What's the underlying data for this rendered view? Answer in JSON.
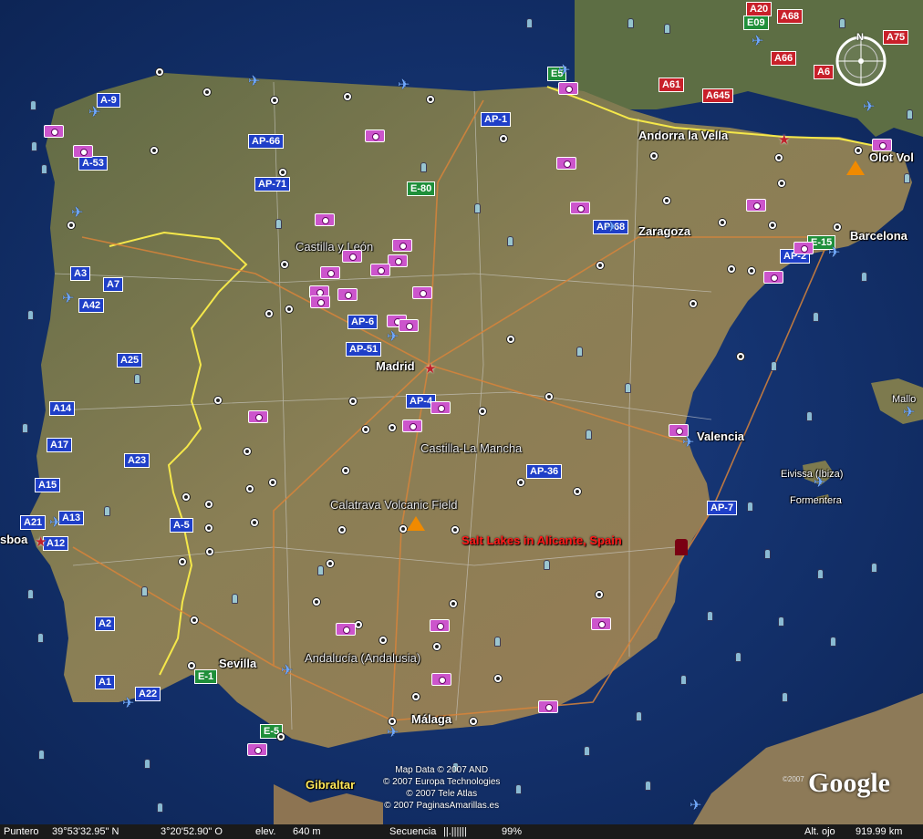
{
  "map": {
    "places": [
      {
        "key": "andorra",
        "label": "Andorra la Vella"
      },
      {
        "key": "olot",
        "label": "Olot Vol"
      },
      {
        "key": "zaragoza",
        "label": "Zaragoza"
      },
      {
        "key": "barcelona",
        "label": "Barcelona"
      },
      {
        "key": "castilla_leon",
        "label": "Castilla y León"
      },
      {
        "key": "madrid",
        "label": "Madrid"
      },
      {
        "key": "valencia",
        "label": "Valencia"
      },
      {
        "key": "castilla_mancha",
        "label": "Castilla-La Mancha"
      },
      {
        "key": "mallorca",
        "label": "Mallo"
      },
      {
        "key": "eivissa",
        "label": "Eivissa (Ibiza)"
      },
      {
        "key": "formentera",
        "label": "Formentera"
      },
      {
        "key": "lisboa",
        "label": "sboa"
      },
      {
        "key": "calatrava",
        "label": "Calatrava Volcanic Field"
      },
      {
        "key": "sevilla",
        "label": "Sevilla"
      },
      {
        "key": "andalucia",
        "label": "Andalucía (Andalusia)"
      },
      {
        "key": "malaga",
        "label": "Málaga"
      },
      {
        "key": "gibraltar",
        "label": "Gibraltar"
      }
    ],
    "feature_label": "Salt Lakes in Alicante, Spain",
    "roads": [
      {
        "key": "e09",
        "label": "E09",
        "color": "green"
      },
      {
        "key": "a68",
        "label": "A68",
        "color": "red"
      },
      {
        "key": "a20",
        "label": "A20",
        "color": "red"
      },
      {
        "key": "a75",
        "label": "A75",
        "color": "red"
      },
      {
        "key": "a66",
        "label": "A66",
        "color": "red"
      },
      {
        "key": "a6x",
        "label": "A6",
        "color": "red"
      },
      {
        "key": "a61",
        "label": "A61",
        "color": "red"
      },
      {
        "key": "a645",
        "label": "A645",
        "color": "red"
      },
      {
        "key": "e5",
        "label": "E5",
        "color": "green"
      },
      {
        "key": "a9",
        "label": "A-9",
        "color": "blue"
      },
      {
        "key": "ap1",
        "label": "AP-1",
        "color": "blue"
      },
      {
        "key": "a53",
        "label": "A-53",
        "color": "blue"
      },
      {
        "key": "ap66",
        "label": "AP-66",
        "color": "blue"
      },
      {
        "key": "ap71",
        "label": "AP-71",
        "color": "blue"
      },
      {
        "key": "e80",
        "label": "E-80",
        "color": "green"
      },
      {
        "key": "ap68",
        "label": "AP-68",
        "color": "blue"
      },
      {
        "key": "ap2",
        "label": "AP-2",
        "color": "blue"
      },
      {
        "key": "e15",
        "label": "E-15",
        "color": "green"
      },
      {
        "key": "a3",
        "label": "A3",
        "color": "blue"
      },
      {
        "key": "a7",
        "label": "A7",
        "color": "blue"
      },
      {
        "key": "a42",
        "label": "A42",
        "color": "blue"
      },
      {
        "key": "ap6",
        "label": "AP-6",
        "color": "blue"
      },
      {
        "key": "ap51",
        "label": "AP-51",
        "color": "blue"
      },
      {
        "key": "a25",
        "label": "A25",
        "color": "blue"
      },
      {
        "key": "ap4",
        "label": "AP-4",
        "color": "blue"
      },
      {
        "key": "a14",
        "label": "A14",
        "color": "blue"
      },
      {
        "key": "a17",
        "label": "A17",
        "color": "blue"
      },
      {
        "key": "a23",
        "label": "A23",
        "color": "blue"
      },
      {
        "key": "a15",
        "label": "A15",
        "color": "blue"
      },
      {
        "key": "ap36",
        "label": "AP-36",
        "color": "blue"
      },
      {
        "key": "a21",
        "label": "A21",
        "color": "blue"
      },
      {
        "key": "a13",
        "label": "A13",
        "color": "blue"
      },
      {
        "key": "a12",
        "label": "A12",
        "color": "blue"
      },
      {
        "key": "a5",
        "label": "A-5",
        "color": "blue"
      },
      {
        "key": "ap7",
        "label": "AP-7",
        "color": "blue"
      },
      {
        "key": "a2",
        "label": "A2",
        "color": "blue"
      },
      {
        "key": "a1",
        "label": "A1",
        "color": "blue"
      },
      {
        "key": "a22",
        "label": "A22",
        "color": "blue"
      },
      {
        "key": "e1",
        "label": "E-1",
        "color": "green"
      },
      {
        "key": "e5b",
        "label": "E-5",
        "color": "green"
      }
    ],
    "attribution": [
      "Map Data © 2007 AND",
      "© 2007 Europa Technologies",
      "© 2007 Tele Atlas",
      "© 2007 PaginasAmarillas.es"
    ],
    "logo": "Google",
    "logo_copyright": "©2007",
    "compass_north": "N",
    "colors": {
      "sea": "#15336e",
      "land": "#7d7a4e",
      "border": "#f5e84a",
      "road": "#d8843a",
      "cam": "#cc55cc",
      "plane": "#6fa8ff"
    }
  },
  "status": {
    "pointer_label": "Puntero",
    "lat": "39°53'32.95\" N",
    "lon": "3°20'52.90\" O",
    "elev_label": "elev.",
    "elev_value": "640 m",
    "seq_label": "Secuencia",
    "seq_bar": "||.||||||",
    "seq_percent": "99%",
    "eye_label": "Alt. ojo",
    "eye_value": "919.99 km"
  }
}
